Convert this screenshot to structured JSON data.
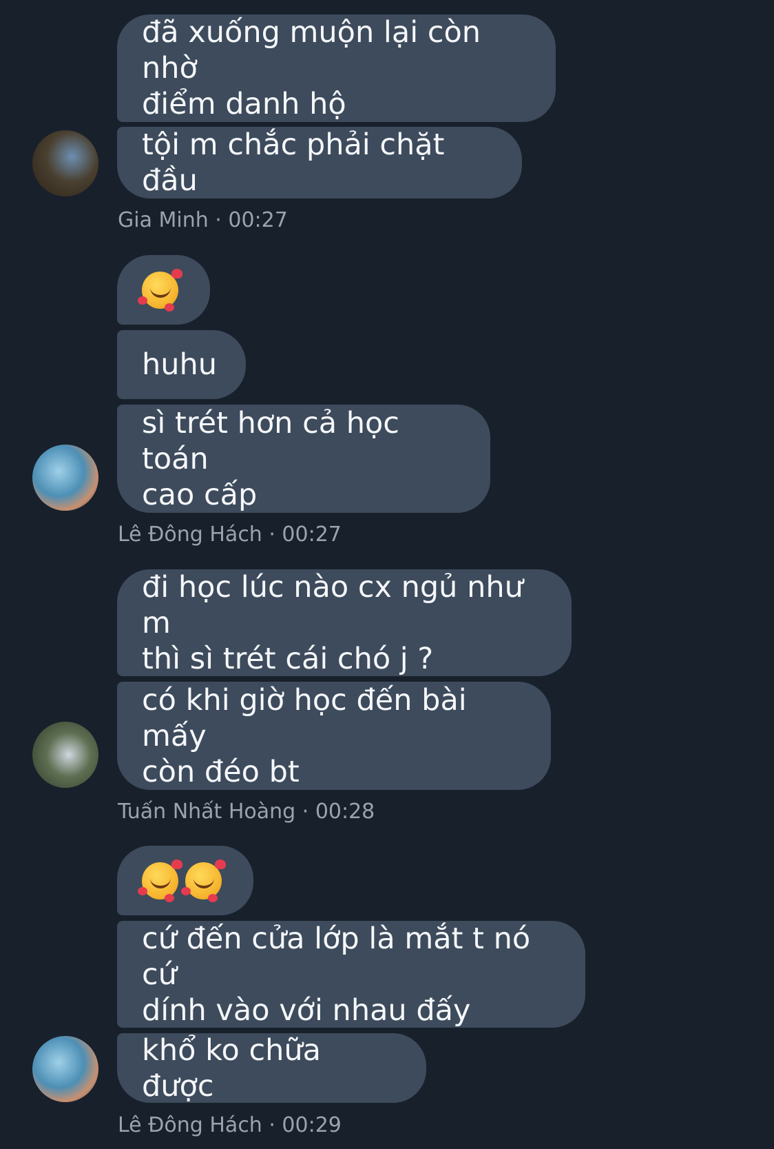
{
  "groups": [
    {
      "sender": "Gia Minh",
      "time": "00:27",
      "meta": "Gia Minh · 00:27",
      "avatar": "avatar-gia-minh",
      "messages": [
        "đã xuống muộn lại còn nhờ\nđiểm danh hộ",
        "tội m chắc phải chặt đầu"
      ]
    },
    {
      "sender": "Lê Đông Hách",
      "time": "00:27",
      "meta": "Lê Đông Hách · 00:27",
      "avatar": "avatar-le-dong-hach",
      "messages": [
        "smiling-face-with-hearts-emoji",
        "huhu",
        "sì trét hơn cả học toán\ncao cấp"
      ]
    },
    {
      "sender": "Tuấn Nhất Hoàng",
      "time": "00:28",
      "meta": "Tuấn Nhất Hoàng · 00:28",
      "avatar": "avatar-tuan-nhat-hoang",
      "messages": [
        "đi học lúc nào cx ngủ như m\nthì sì trét cái chó j ?",
        "có khi giờ học đến bài mấy\ncòn đéo bt"
      ]
    },
    {
      "sender": "Lê Đông Hách",
      "time": "00:29",
      "meta": "Lê Đông Hách · 00:29",
      "avatar": "avatar-le-dong-hach",
      "messages": [
        "smiling-face-with-hearts-emoji x2",
        "cứ đến cửa lớp là mắt t nó cứ\ndính vào với nhau đấy",
        "khổ ko chữa được"
      ]
    }
  ]
}
